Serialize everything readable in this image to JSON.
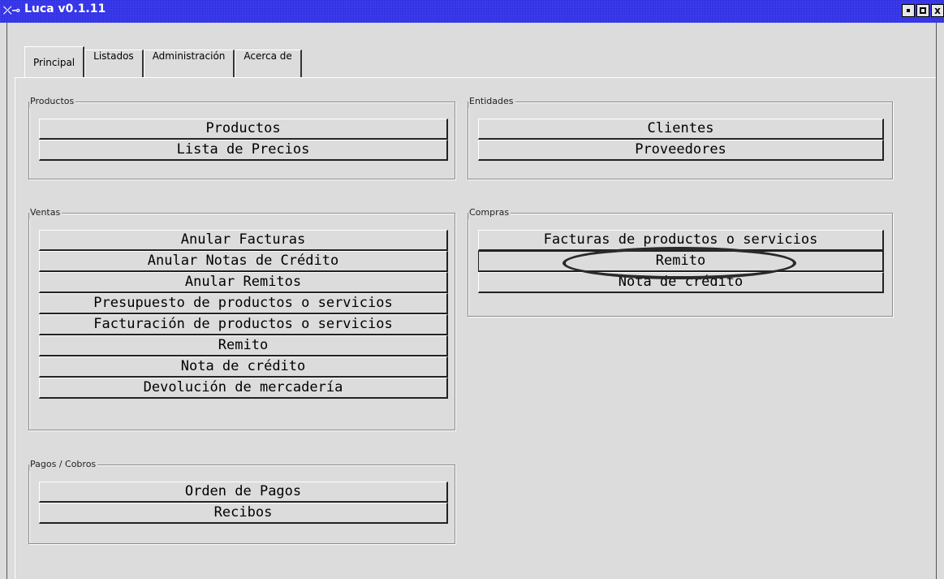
{
  "window": {
    "title": "Luca v0.1.11",
    "title_icon": "app-icon",
    "controls": {
      "minimize": "",
      "maximize": "",
      "close": "x"
    }
  },
  "tabs": [
    {
      "label": "Principal",
      "active": true
    },
    {
      "label": "Listados",
      "active": false
    },
    {
      "label": "Administración",
      "active": false
    },
    {
      "label": "Acerca de",
      "active": false
    }
  ],
  "groups": {
    "productos": {
      "title": "Productos",
      "buttons": [
        "Productos",
        "Lista de Precios"
      ]
    },
    "entidades": {
      "title": "Entidades",
      "buttons": [
        "Clientes",
        "Proveedores"
      ]
    },
    "ventas": {
      "title": "Ventas",
      "buttons": [
        "Anular Facturas",
        "Anular Notas de Crédito",
        "Anular Remitos",
        "Presupuesto de productos o servicios",
        "Facturación de productos o servicios",
        "Remito",
        "Nota de crédito",
        "Devolución de mercadería"
      ]
    },
    "compras": {
      "title": "Compras",
      "buttons": [
        "Facturas de productos o servicios",
        "Remito",
        "Nota de crédito"
      ],
      "highlighted_button": "Remito"
    },
    "pagos": {
      "title": "Pagos / Cobros",
      "buttons": [
        "Orden de Pagos",
        "Recibos"
      ]
    }
  }
}
